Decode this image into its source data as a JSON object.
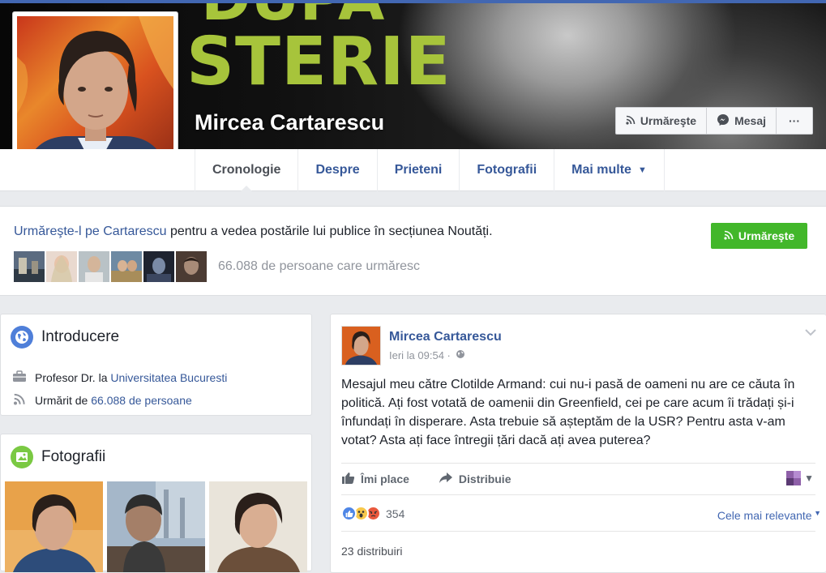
{
  "cover": {
    "text_top": "DUPA",
    "text_main": "STERIE",
    "name": "Mircea Cartarescu",
    "actions": {
      "follow_label": "Urmăreşte",
      "message_label": "Mesaj",
      "more_label": "···"
    }
  },
  "nav": {
    "tabs": [
      {
        "label": "Cronologie"
      },
      {
        "label": "Despre"
      },
      {
        "label": "Prieteni"
      },
      {
        "label": "Fotografii"
      },
      {
        "label": "Mai multe"
      }
    ]
  },
  "follow_bar": {
    "link_text": "Urmăreşte-l pe Cartarescu",
    "rest_text": " pentru a vedea postările lui publice în secțiunea Noutăți.",
    "button_label": "Urmăreşte",
    "followers_text": "66.088 de persoane care urmăresc"
  },
  "intro": {
    "title": "Introducere",
    "job_prefix": "Profesor Dr. la ",
    "job_link": "Universitatea Bucuresti",
    "followed_prefix": "Urmărit de ",
    "followed_link": "66.088 de persoane"
  },
  "photos": {
    "title": "Fotografii"
  },
  "post": {
    "author": "Mircea Cartarescu",
    "time": "Ieri la 09:54 ·",
    "body": "Mesajul meu către Clotilde Armand: cui nu-i pasă de oameni nu are ce căuta în politică. Ați fost votată de oamenii din Greenfield, cei pe care acum îi trădați și-i înfundați în disperare. Asta trebuie să așteptăm de la USR? Pentru asta v-am votat? Asta ați face întregii țări dacă ați avea puterea?",
    "like_label": "Îmi place",
    "share_label": "Distribuie",
    "reaction_count": "354",
    "relevance_label": "Cele mai relevante",
    "shares_text": "23 distribuiri"
  },
  "colors": {
    "link": "#365899",
    "green_button": "#42b72a",
    "cover_title": "#a7c43b",
    "background": "#e9ebee"
  }
}
